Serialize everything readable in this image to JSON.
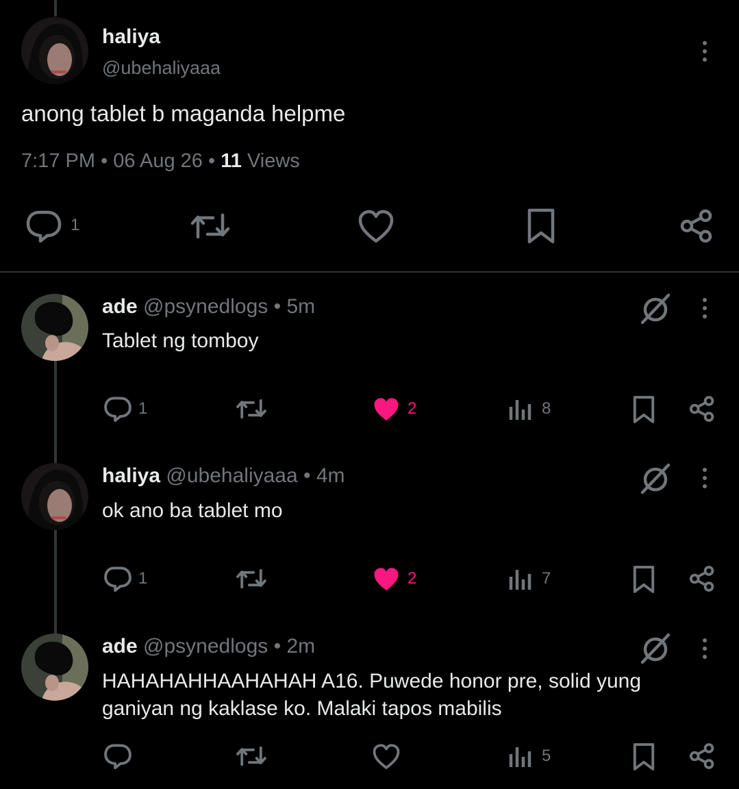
{
  "main_post": {
    "display_name": "haliya",
    "handle": "@ubehaliyaaa",
    "text": "anong tablet b maganda helpme",
    "time": "7:17 PM",
    "date": "06 Aug 26",
    "views_count": "11",
    "views_label": "Views",
    "reply_count": "1",
    "icons": [
      "reply-icon",
      "repost-icon",
      "like-icon",
      "bookmark-icon",
      "share-icon"
    ]
  },
  "replies": [
    {
      "display_name": "ade",
      "handle": "@psynedlogs",
      "age": "5m",
      "text": "Tablet ng tomboy",
      "reply_count": "1",
      "like_count": "2",
      "liked": true,
      "view_count": "8"
    },
    {
      "display_name": "haliya",
      "handle": "@ubehaliyaaa",
      "age": "4m",
      "text": "ok ano ba tablet mo",
      "reply_count": "1",
      "like_count": "2",
      "liked": true,
      "view_count": "7"
    },
    {
      "display_name": "ade",
      "handle": "@psynedlogs",
      "age": "2m",
      "text_lines": [
        "HAHAHAHHAAHAHAH A16. Puwede honor pre, solid yung",
        "ganiyan ng kaklase ko. Malaki tapos mabilis"
      ],
      "reply_count": "",
      "like_count": "",
      "liked": false,
      "view_count": "5"
    }
  ],
  "colors": {
    "background": "#000000",
    "text": "#e7e9ea",
    "muted": "#71767b",
    "like_active": "#f91880"
  },
  "separator": "•"
}
